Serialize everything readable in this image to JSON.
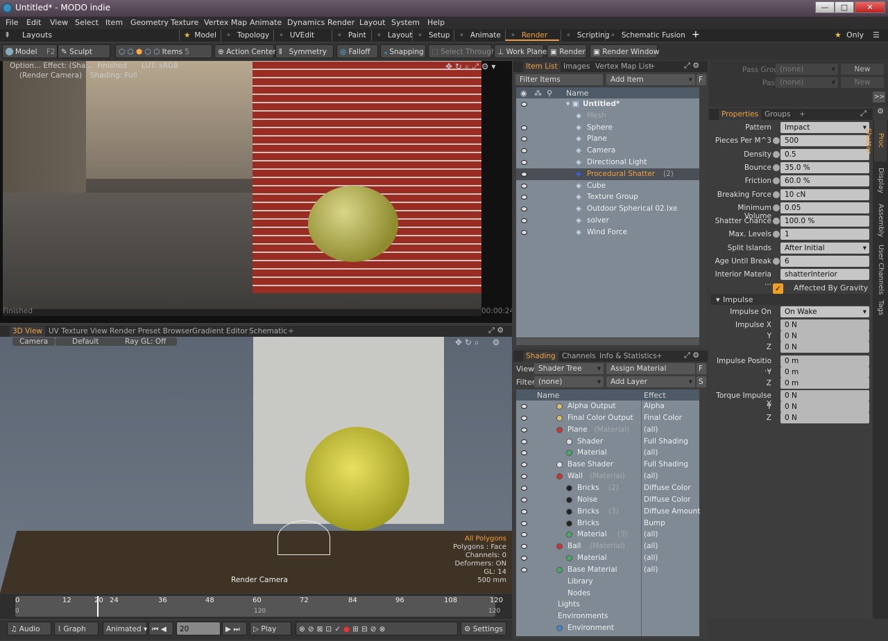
{
  "window": {
    "title": "Untitled* - MODO indie",
    "min": "—",
    "max": "□",
    "close": "✕"
  },
  "menu": [
    "File",
    "Edit",
    "View",
    "Select",
    "Item",
    "Geometry",
    "Texture",
    "Vertex Map",
    "Animate",
    "Dynamics",
    "Render",
    "Layout",
    "System",
    "Help"
  ],
  "layouts": {
    "label": "Layouts",
    "tabs": [
      "Model",
      "Topology",
      "UVEdit",
      "Paint",
      "Layout",
      "Setup",
      "Animate",
      "Render",
      "Scripting",
      "Schematic Fusion"
    ],
    "active": "Render",
    "only": "Only"
  },
  "toolbar": {
    "model": "Model",
    "model_key": "F2",
    "sculpt": "Sculpt",
    "items": "Items",
    "items_key": "5",
    "action_center": "Action Center",
    "symmetry": "Symmetry",
    "falloff": "Falloff",
    "snapping": "Snapping",
    "select_through": "Select Through",
    "work_plane": "Work Plane",
    "render": "Render",
    "render_window": "Render Window"
  },
  "render_view": {
    "option": "Option... Effect: (Sha...",
    "finished": "Finished",
    "lut": "LUT: sRGB",
    "camera": "(Render Camera)",
    "shading": "Shading: Full",
    "status_left": "Finished",
    "time": "00:00:24"
  },
  "view_tabs": [
    "3D View",
    "UV Texture View",
    "Render Preset Browser",
    "Gradient Editor",
    "Schematic"
  ],
  "viewport": {
    "camera": "Camera",
    "default": "Default",
    "raygl": "Ray GL: Off",
    "render_camera": "Render Camera",
    "stats": [
      "All Polygons",
      "Polygons : Face",
      "Channels: 0",
      "Deformers: ON",
      "GL: 14",
      "500 mm"
    ]
  },
  "timeline": {
    "ticks": [
      "0",
      "12",
      "20",
      "24",
      "36",
      "48",
      "60",
      "72",
      "84",
      "96",
      "108",
      "120"
    ],
    "lower": [
      "0",
      "120",
      "120"
    ]
  },
  "transport": {
    "audio": "Audio",
    "graph": "Graph",
    "animated": "Animated",
    "frame": "20",
    "play": "Play",
    "settings": "Settings"
  },
  "item_list": {
    "tabs": [
      "Item List",
      "Images",
      "Vertex Map List"
    ],
    "filter": "Filter Items",
    "add": "Add Item",
    "f": "F",
    "col_name": "Name",
    "items": [
      {
        "name": "Untitled*",
        "suffix": "",
        "indent": 0,
        "bold": true
      },
      {
        "name": "Mesh",
        "suffix": "",
        "indent": 1,
        "dim": true
      },
      {
        "name": "Sphere",
        "suffix": "",
        "indent": 1
      },
      {
        "name": "Plane",
        "suffix": "",
        "indent": 1
      },
      {
        "name": "Camera",
        "suffix": "",
        "indent": 1
      },
      {
        "name": "Directional Light",
        "suffix": "",
        "indent": 1
      },
      {
        "name": "Procedural Shatter",
        "suffix": "(2)",
        "indent": 1,
        "sel": true
      },
      {
        "name": "Cube",
        "suffix": "",
        "indent": 1
      },
      {
        "name": "Texture Group",
        "suffix": "",
        "indent": 1
      },
      {
        "name": "Outdoor Spherical 02.lxe",
        "suffix": "",
        "indent": 1
      },
      {
        "name": "solver",
        "suffix": "",
        "indent": 1
      },
      {
        "name": "Wind Force",
        "suffix": "",
        "indent": 1
      }
    ]
  },
  "pass": {
    "groups": "Pass Groups",
    "passes": "Passes",
    "none": "(none)",
    "new": "New",
    "more": ">>"
  },
  "props": {
    "tabs": [
      "Properties",
      "Groups"
    ],
    "rows": [
      {
        "label": "Pattern",
        "value": "Impact",
        "dd": true
      },
      {
        "label": "Pieces Per M^3",
        "value": "500"
      },
      {
        "label": "Density",
        "value": "0.5"
      },
      {
        "label": "Bounce",
        "value": "35.0 %"
      },
      {
        "label": "Friction",
        "value": "60.0 %"
      },
      {
        "label": "Breaking Force",
        "value": "10 cN"
      },
      {
        "label": "Minimum Volume",
        "value": "0.05"
      },
      {
        "label": "Shatter Chance",
        "value": "100.0 %"
      },
      {
        "label": "Max. Levels",
        "value": "1"
      },
      {
        "label": "Split Islands",
        "value": "After Initial",
        "dd": true
      },
      {
        "label": "Age Until Break",
        "value": "6"
      },
      {
        "label": "Interior Materia ...",
        "value": "shatterInterior"
      }
    ],
    "gravity": "Affected By Gravity",
    "impulse": "Impulse",
    "impulse_on": "Impulse On",
    "wake": "On Wake",
    "ix": "Impulse X",
    "y": "Y",
    "z": "Z",
    "pos": "Impulse Positio ...",
    "torque": "Torque Impulse X",
    "zero_n": "0 N",
    "zero_m": "0 m"
  },
  "side_tabs": [
    "Proc Shatter",
    "Display",
    "Assembly",
    "User Channels",
    "Tags"
  ],
  "shading": {
    "tabs": [
      "Shading",
      "Channels",
      "Info & Statistics"
    ],
    "view": "View",
    "tree": "Shader Tree",
    "assign": "Assign Material",
    "filter": "Filter",
    "none": "(none)",
    "add_layer": "Add Layer",
    "f": "F",
    "s": "S",
    "col_name": "Name",
    "col_effect": "Effect",
    "rows": [
      {
        "name": "Alpha Output",
        "sfx": "",
        "effect": "Alpha",
        "ind": 1,
        "c": "#d8c070"
      },
      {
        "name": "Final Color Output",
        "sfx": "",
        "effect": "Final Color",
        "ind": 1,
        "c": "#d8c070"
      },
      {
        "name": "Plane",
        "sfx": "(Material)",
        "effect": "(all)",
        "ind": 1,
        "c": "#c33"
      },
      {
        "name": "Shader",
        "sfx": "",
        "effect": "Full Shading",
        "ind": 2,
        "c": "#ddd"
      },
      {
        "name": "Material",
        "sfx": "",
        "effect": "(all)",
        "ind": 2,
        "c": "#4a6"
      },
      {
        "name": "Base Shader",
        "sfx": "",
        "effect": "Full Shading",
        "ind": 1,
        "c": "#ddd"
      },
      {
        "name": "Wall",
        "sfx": "(Material)",
        "effect": "(all)",
        "ind": 1,
        "c": "#c33"
      },
      {
        "name": "Bricks",
        "sfx": "(2)",
        "effect": "Diffuse Color",
        "ind": 2,
        "c": "#222"
      },
      {
        "name": "Noise",
        "sfx": "",
        "effect": "Diffuse Color",
        "ind": 2,
        "c": "#222"
      },
      {
        "name": "Bricks",
        "sfx": "(3)",
        "effect": "Diffuse Amount",
        "ind": 2,
        "c": "#222"
      },
      {
        "name": "Bricks",
        "sfx": "",
        "effect": "Bump",
        "ind": 2,
        "c": "#222"
      },
      {
        "name": "Material",
        "sfx": "(3)",
        "effect": "(all)",
        "ind": 2,
        "c": "#4a6"
      },
      {
        "name": "Ball",
        "sfx": "(Material)",
        "effect": "(all)",
        "ind": 1,
        "c": "#c33"
      },
      {
        "name": "Material",
        "sfx": "",
        "effect": "(all)",
        "ind": 2,
        "c": "#4a6"
      },
      {
        "name": "Base Material",
        "sfx": "",
        "effect": "(all)",
        "ind": 1,
        "c": "#4a6"
      },
      {
        "name": "Library",
        "sfx": "",
        "effect": "",
        "ind": 1,
        "c": ""
      },
      {
        "name": "Nodes",
        "sfx": "",
        "effect": "",
        "ind": 1,
        "c": ""
      },
      {
        "name": "Lights",
        "sfx": "",
        "effect": "",
        "ind": 0,
        "c": ""
      },
      {
        "name": "Environments",
        "sfx": "",
        "effect": "",
        "ind": 0,
        "c": ""
      },
      {
        "name": "Environment",
        "sfx": "",
        "effect": "",
        "ind": 1,
        "c": "#48c"
      }
    ]
  }
}
